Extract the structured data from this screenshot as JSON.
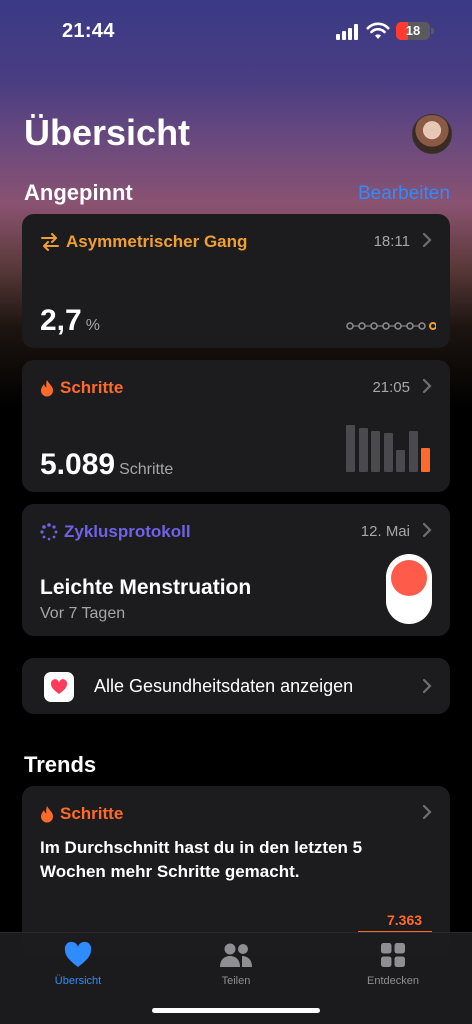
{
  "status_bar": {
    "time": "21:44",
    "battery": "18"
  },
  "header": {
    "title": "Übersicht"
  },
  "pinned": {
    "title": "Angepinnt",
    "edit_label": "Bearbeiten",
    "cards": {
      "gait": {
        "title": "Asymmetrischer Gang",
        "time": "18:11",
        "value": "2,7",
        "unit": "%",
        "color": "#f0a030"
      },
      "steps": {
        "title": "Schritte",
        "time": "21:05",
        "value": "5.089",
        "unit": "Schritte",
        "color": "#ff6a2a",
        "bar_levels": [
          0.98,
          0.92,
          0.86,
          0.82,
          0.45,
          0.86,
          0.5
        ]
      },
      "cycle": {
        "title": "Zyklusprotokoll",
        "time": "12. Mai",
        "headline": "Leichte Menstruation",
        "subline": "Vor 7 Tagen",
        "color": "#6f62e8"
      }
    }
  },
  "all_data": {
    "label": "Alle Gesundheitsdaten anzeigen"
  },
  "trends": {
    "title": "Trends",
    "card": {
      "title": "Schritte",
      "text": "Im Durchschnitt hast du in den letzten 5 Wochen mehr Schritte gemacht.",
      "value": "7.363"
    }
  },
  "tabbar": {
    "tabs": [
      {
        "label": "Übersicht",
        "active": true
      },
      {
        "label": "Teilen",
        "active": false
      },
      {
        "label": "Entdecken",
        "active": false
      }
    ],
    "accent": "#2f8cff"
  }
}
